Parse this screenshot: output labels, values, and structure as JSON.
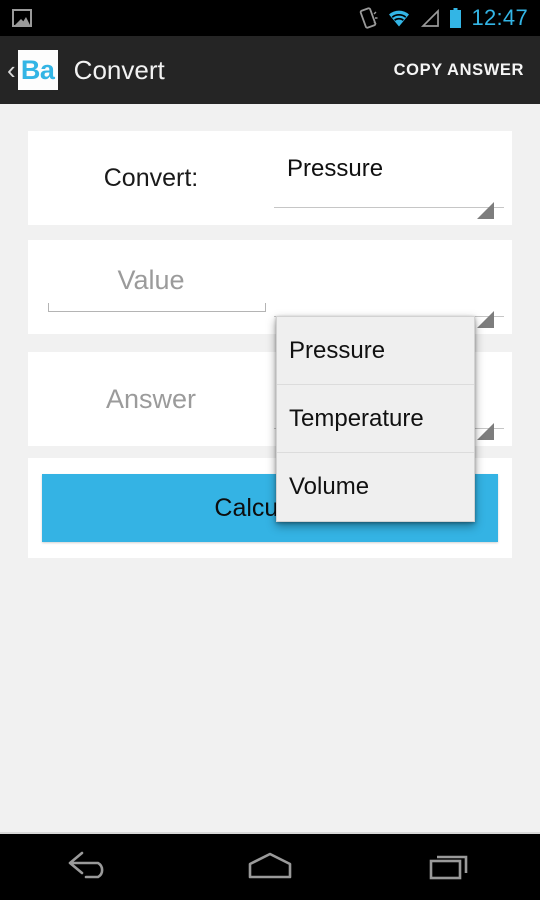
{
  "status_bar": {
    "notification_icon": "image-icon",
    "vibrate_icon": "vibrate-icon",
    "wifi_icon": "wifi-icon",
    "signal_icon": "cellular-signal-icon",
    "battery_icon": "battery-icon",
    "time": "12:47",
    "accent_color": "#33b5e5"
  },
  "action_bar": {
    "back_glyph": "‹",
    "app_icon_text": "Ba",
    "title": "Convert",
    "action_label": "COPY ANSWER",
    "background": "#252525"
  },
  "rows": [
    {
      "label": "Convert:",
      "spinner_value": "Pressure",
      "spinner_arrow": "spinner-triangle-icon"
    },
    {
      "placeholder": "Value",
      "value": "",
      "spinner_arrow": "spinner-triangle-icon"
    },
    {
      "placeholder": "Answer",
      "value": "",
      "spinner_arrow": "spinner-triangle-icon"
    }
  ],
  "calculate": {
    "label": "Calculate:",
    "color": "#34b3e4"
  },
  "dropdown": {
    "open": true,
    "selected": "Pressure",
    "options": [
      "Pressure",
      "Temperature",
      "Volume"
    ]
  },
  "nav_bar": {
    "back": "back-nav-icon",
    "home": "home-nav-icon",
    "recents": "recents-nav-icon"
  }
}
